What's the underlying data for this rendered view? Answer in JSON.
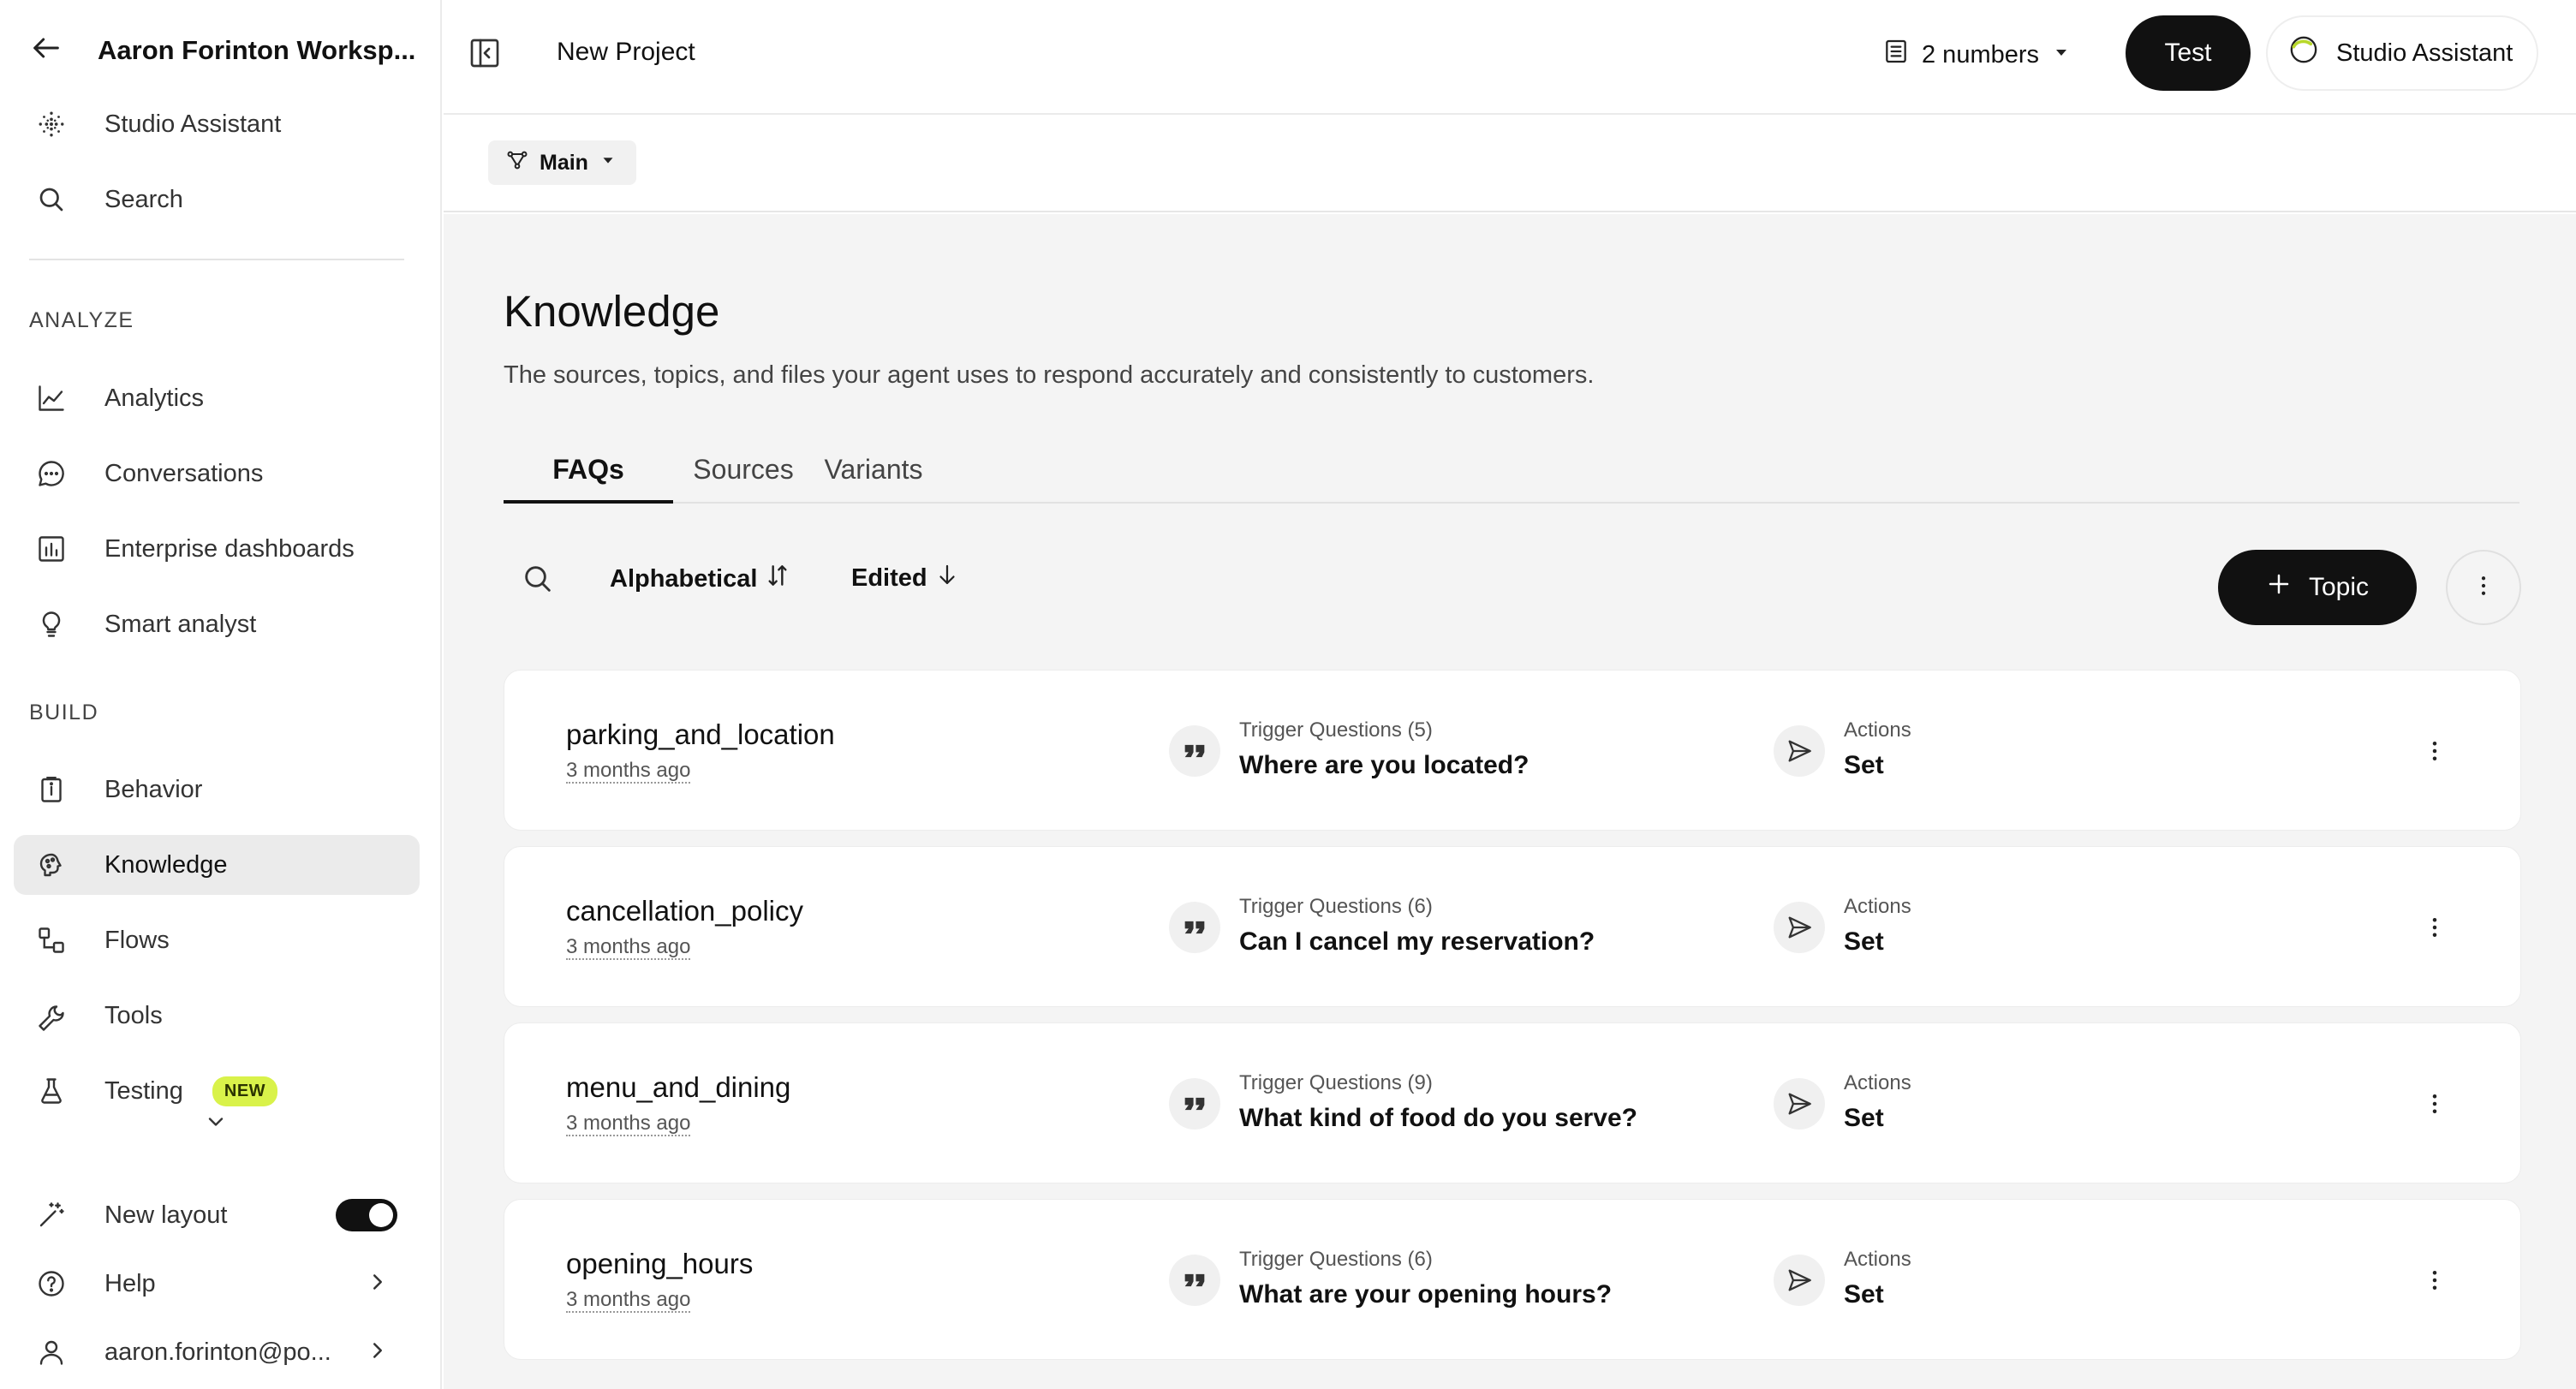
{
  "sidebar": {
    "workspace_title": "Aaron Forinton Worksp...",
    "top_items": [
      {
        "label": "Studio Assistant",
        "icon": "sparkle-dots-icon"
      },
      {
        "label": "Search",
        "icon": "search-icon"
      }
    ],
    "analyze_header": "ANALYZE",
    "analyze_items": [
      {
        "label": "Analytics",
        "icon": "line-chart-icon"
      },
      {
        "label": "Conversations",
        "icon": "chat-bubble-icon"
      },
      {
        "label": "Enterprise dashboards",
        "icon": "bar-chart-icon"
      },
      {
        "label": "Smart analyst",
        "icon": "lightbulb-icon"
      }
    ],
    "build_header": "BUILD",
    "build_items": [
      {
        "label": "Behavior",
        "icon": "clipboard-icon"
      },
      {
        "label": "Knowledge",
        "icon": "brain-icon",
        "active": true
      },
      {
        "label": "Flows",
        "icon": "flow-icon"
      },
      {
        "label": "Tools",
        "icon": "wrench-icon"
      },
      {
        "label": "Testing",
        "icon": "flask-icon",
        "badge": "NEW"
      }
    ],
    "new_layout_label": "New layout",
    "new_layout_enabled": true,
    "help_label": "Help",
    "user_label": "aaron.forinton@po..."
  },
  "header": {
    "project_title": "New Project",
    "numbers_label": "2 numbers",
    "test_label": "Test",
    "assistant_label": "Studio Assistant"
  },
  "subbar": {
    "branch_label": "Main"
  },
  "main": {
    "title": "Knowledge",
    "description": "The sources, topics, and files your agent uses to respond accurately and consistently to customers.",
    "tabs": [
      {
        "label": "FAQs",
        "active": true
      },
      {
        "label": "Sources"
      },
      {
        "label": "Variants"
      }
    ],
    "sort_alpha_label": "Alphabetical",
    "sort_edited_label": "Edited",
    "add_topic_label": "Topic",
    "topics": [
      {
        "name": "parking_and_location",
        "edited": "3 months ago",
        "trigger_meta": "Trigger Questions (5)",
        "trigger_question": "Where are you located?",
        "actions_meta": "Actions",
        "actions_value": "Set"
      },
      {
        "name": "cancellation_policy",
        "edited": "3 months ago",
        "trigger_meta": "Trigger Questions (6)",
        "trigger_question": "Can I cancel my reservation?",
        "actions_meta": "Actions",
        "actions_value": "Set"
      },
      {
        "name": "menu_and_dining",
        "edited": "3 months ago",
        "trigger_meta": "Trigger Questions (9)",
        "trigger_question": "What kind of food do you serve?",
        "actions_meta": "Actions",
        "actions_value": "Set"
      },
      {
        "name": "opening_hours",
        "edited": "3 months ago",
        "trigger_meta": "Trigger Questions (6)",
        "trigger_question": "What are your opening hours?",
        "actions_meta": "Actions",
        "actions_value": "Set"
      }
    ]
  }
}
